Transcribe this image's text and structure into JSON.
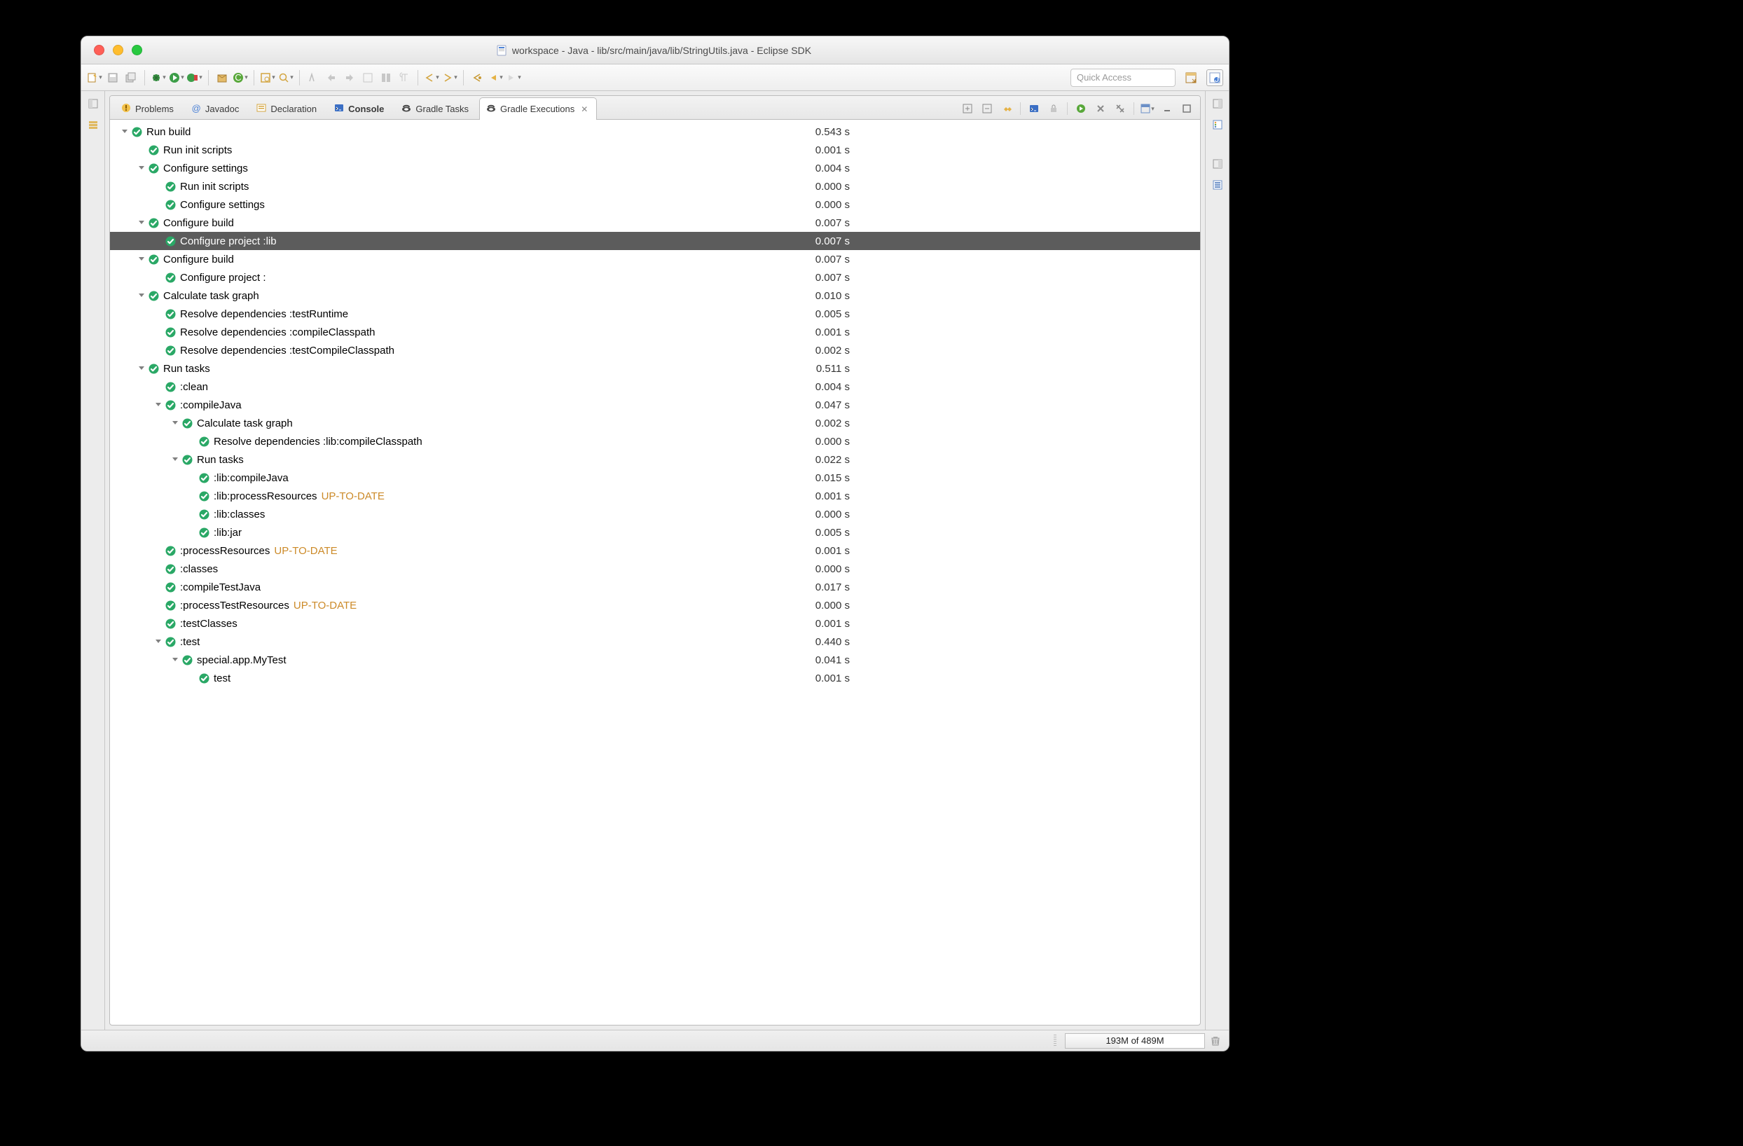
{
  "window_title": "workspace - Java - lib/src/main/java/lib/StringUtils.java - Eclipse SDK",
  "quick_access_placeholder": "Quick Access",
  "tabs": [
    {
      "label": "Problems"
    },
    {
      "label": "Javadoc"
    },
    {
      "label": "Declaration"
    },
    {
      "label": "Console",
      "bold": true
    },
    {
      "label": "Gradle Tasks"
    },
    {
      "label": "Gradle Executions",
      "active": true
    }
  ],
  "tree": [
    {
      "d": 0,
      "tw": "▼",
      "label": "Run build",
      "time": "0.543 s"
    },
    {
      "d": 1,
      "label": "Run init scripts",
      "time": "0.001 s"
    },
    {
      "d": 1,
      "tw": "▼",
      "label": "Configure settings",
      "time": "0.004 s"
    },
    {
      "d": 2,
      "label": "Run init scripts",
      "time": "0.000 s"
    },
    {
      "d": 2,
      "label": "Configure settings",
      "time": "0.000 s"
    },
    {
      "d": 1,
      "tw": "▼",
      "label": "Configure build",
      "time": "0.007 s"
    },
    {
      "d": 2,
      "label": "Configure project :lib",
      "time": "0.007 s",
      "selected": true
    },
    {
      "d": 1,
      "tw": "▼",
      "label": "Configure build",
      "time": "0.007 s"
    },
    {
      "d": 2,
      "label": "Configure project :",
      "time": "0.007 s"
    },
    {
      "d": 1,
      "tw": "▼",
      "label": "Calculate task graph",
      "time": "0.010 s"
    },
    {
      "d": 2,
      "label": "Resolve dependencies :testRuntime",
      "time": "0.005 s"
    },
    {
      "d": 2,
      "label": "Resolve dependencies :compileClasspath",
      "time": "0.001 s"
    },
    {
      "d": 2,
      "label": "Resolve dependencies :testCompileClasspath",
      "time": "0.002 s"
    },
    {
      "d": 1,
      "tw": "▼",
      "label": "Run tasks",
      "time": "0.511 s"
    },
    {
      "d": 2,
      "label": ":clean",
      "time": "0.004 s"
    },
    {
      "d": 2,
      "tw": "▼",
      "label": ":compileJava",
      "time": "0.047 s"
    },
    {
      "d": 3,
      "tw": "▼",
      "label": "Calculate task graph",
      "time": "0.002 s"
    },
    {
      "d": 4,
      "label": "Resolve dependencies :lib:compileClasspath",
      "time": "0.000 s"
    },
    {
      "d": 3,
      "tw": "▼",
      "label": "Run tasks",
      "time": "0.022 s"
    },
    {
      "d": 4,
      "label": ":lib:compileJava",
      "time": "0.015 s"
    },
    {
      "d": 4,
      "label": ":lib:processResources",
      "suffix": "UP-TO-DATE",
      "time": "0.001 s"
    },
    {
      "d": 4,
      "label": ":lib:classes",
      "time": "0.000 s"
    },
    {
      "d": 4,
      "label": ":lib:jar",
      "time": "0.005 s"
    },
    {
      "d": 2,
      "label": ":processResources",
      "suffix": "UP-TO-DATE",
      "time": "0.001 s"
    },
    {
      "d": 2,
      "label": ":classes",
      "time": "0.000 s"
    },
    {
      "d": 2,
      "label": ":compileTestJava",
      "time": "0.017 s"
    },
    {
      "d": 2,
      "label": ":processTestResources",
      "suffix": "UP-TO-DATE",
      "time": "0.000 s"
    },
    {
      "d": 2,
      "label": ":testClasses",
      "time": "0.001 s"
    },
    {
      "d": 2,
      "tw": "▼",
      "label": ":test",
      "time": "0.440 s"
    },
    {
      "d": 3,
      "tw": "▼",
      "label": "special.app.MyTest",
      "time": "0.041 s"
    },
    {
      "d": 4,
      "label": "test",
      "time": "0.001 s"
    }
  ],
  "heap": {
    "text": "193M of 489M",
    "pct": 39
  }
}
